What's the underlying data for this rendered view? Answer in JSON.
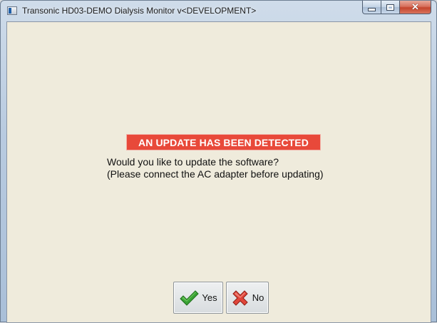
{
  "window": {
    "title": "Transonic HD03-DEMO Dialysis Monitor v<DEVELOPMENT>",
    "controls": {
      "minimize_icon": "minimize-icon",
      "maximize_icon": "maximize-icon",
      "close_icon": "close-icon",
      "close_glyph": "✕"
    }
  },
  "dialog": {
    "banner": "AN UPDATE HAS BEEN DETECTED",
    "message_line1": "Would you like to update the software?",
    "message_line2": "(Please connect the AC adapter before updating)",
    "buttons": {
      "yes_label": "Yes",
      "yes_icon": "checkmark-icon",
      "no_label": "No",
      "no_icon": "x-mark-icon"
    }
  },
  "colors": {
    "banner_bg": "#e8493a",
    "client_bg": "#efebdc",
    "check_green": "#3aa335",
    "x_red": "#e0453a"
  }
}
